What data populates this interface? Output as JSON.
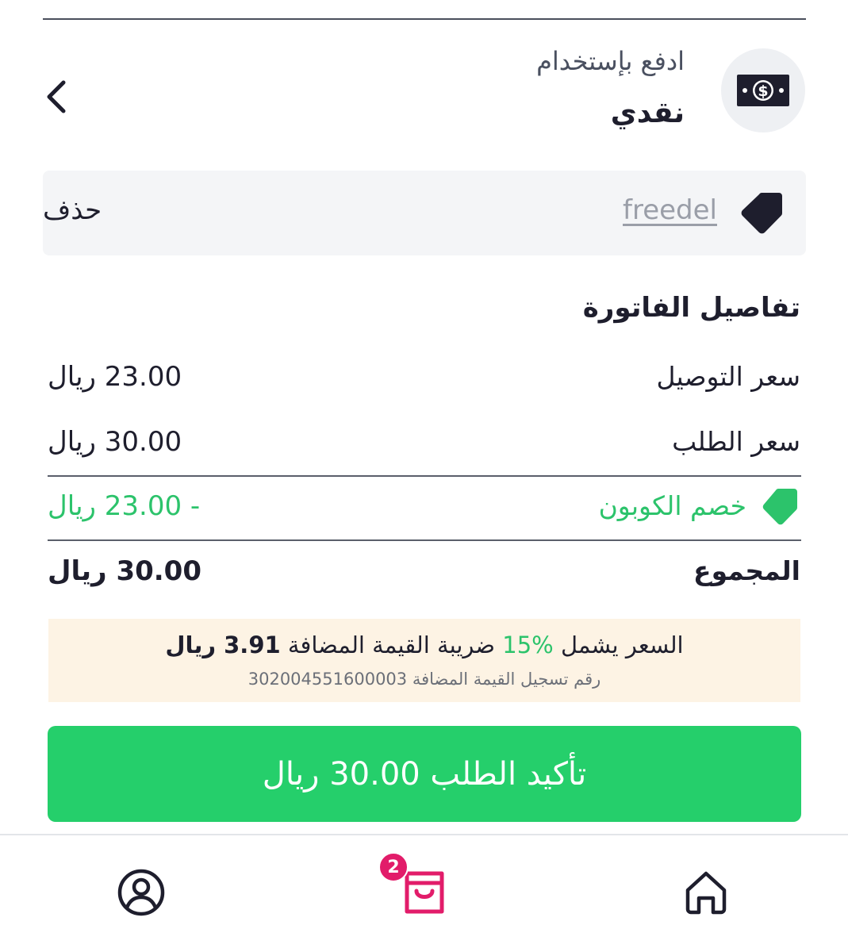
{
  "payment": {
    "label": "ادفع بإستخدام",
    "method": "نقدي",
    "icon": "cash-icon"
  },
  "coupon": {
    "code": "freedel",
    "delete_label": "حذف",
    "icon": "tag-icon"
  },
  "invoice": {
    "title": "تفاصيل الفاتورة",
    "rows": [
      {
        "label": "سعر التوصيل",
        "value": "23.00 ريال"
      },
      {
        "label": "سعر الطلب",
        "value": "30.00 ريال"
      },
      {
        "label": "خصم الكوبون",
        "value": "- 23.00 ريال"
      },
      {
        "label": "المجموع",
        "value": "30.00 ريال"
      }
    ]
  },
  "vat": {
    "prefix": "السعر يشمل",
    "percent": "15%",
    "suffix": "ضريبة القيمة المضافة",
    "amount": "3.91 ريال",
    "registration": "رقم تسجيل القيمة المضافة 302004551600003"
  },
  "confirm": {
    "label": "تأكيد الطلب 30.00 ريال"
  },
  "nav": {
    "cart_count": "2"
  },
  "colors": {
    "accent_green": "#25cf6b",
    "text_dark": "#1e1e2d",
    "badge_pink": "#e21c6a",
    "vat_bg": "#fdf3e4"
  }
}
